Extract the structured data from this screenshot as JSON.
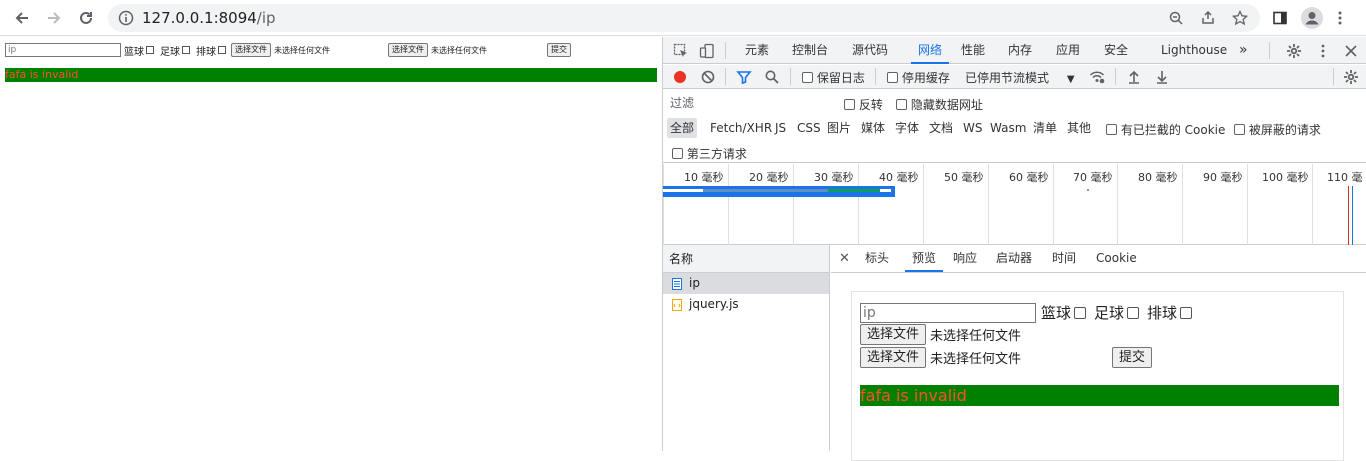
{
  "browser": {
    "url_host": "127.0.0.1:8094",
    "url_path": "/ip"
  },
  "page": {
    "input_placeholder": "ip",
    "labels": [
      "篮球",
      "足球",
      "排球"
    ],
    "file_button": "选择文件",
    "no_file_text": "未选择任何文件",
    "submit": "提交",
    "message": "fafa is invalid",
    "message_bg": "#008000",
    "message_color": "#ff4d2e"
  },
  "devtools": {
    "tabs": [
      "元素",
      "控制台",
      "源代码",
      "网络",
      "性能",
      "内存",
      "应用",
      "安全",
      "Lighthouse"
    ],
    "active_tab": "网络",
    "toolbar": {
      "preserve_log": "保留日志",
      "disable_cache": "停用缓存",
      "throttle": "已停用节流模式"
    },
    "filter": {
      "placeholder": "过滤",
      "invert": "反转",
      "hide_data_urls": "隐藏数据网址",
      "types": [
        "全部",
        "Fetch/XHR",
        "JS",
        "CSS",
        "图片",
        "媒体",
        "字体",
        "文档",
        "WS",
        "Wasm",
        "清单",
        "其他"
      ],
      "blocked_cookies": "有已拦截的 Cookie",
      "blocked_requests": "被屏蔽的请求",
      "third_party": "第三方请求"
    },
    "timeline_ticks": [
      "10 毫秒",
      "20 毫秒",
      "30 毫秒",
      "40 毫秒",
      "50 毫秒",
      "60 毫秒",
      "70 毫秒",
      "80 毫秒",
      "90 毫秒",
      "100 毫秒",
      "110 毫"
    ],
    "name_header": "名称",
    "requests": [
      "ip",
      "jquery.js"
    ],
    "detail_tabs": [
      "标头",
      "预览",
      "响应",
      "启动器",
      "时间",
      "Cookie"
    ],
    "active_detail_tab": "预览"
  }
}
